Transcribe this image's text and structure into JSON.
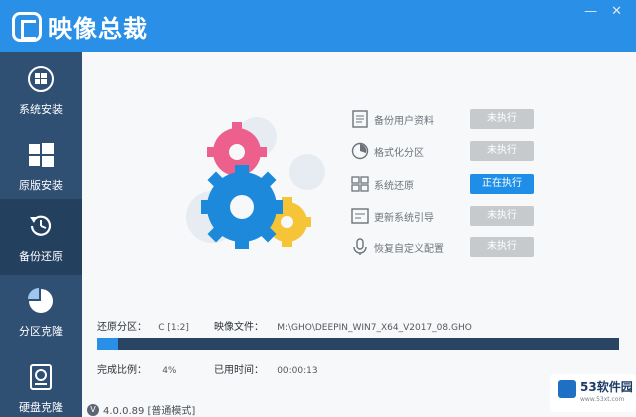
{
  "app": {
    "title": "映像总裁"
  },
  "window_controls": {
    "minimize": "—",
    "close": "✕"
  },
  "sidebar": {
    "items": [
      {
        "label": "系统安装",
        "icon": "windows-disc-icon"
      },
      {
        "label": "原版安装",
        "icon": "windows-logo-icon"
      },
      {
        "label": "备份还原",
        "icon": "backup-restore-icon",
        "active": true
      },
      {
        "label": "分区克隆",
        "icon": "pie-chart-icon"
      },
      {
        "label": "硬盘克隆",
        "icon": "disk-clone-icon"
      }
    ]
  },
  "tasks": [
    {
      "label": "备份用户资料",
      "status": "未执行",
      "icon": "document-icon"
    },
    {
      "label": "格式化分区",
      "status": "未执行",
      "icon": "format-disc-icon"
    },
    {
      "label": "系统还原",
      "status": "正在执行",
      "icon": "windows-grid-icon",
      "running": true
    },
    {
      "label": "更新系统引导",
      "status": "未执行",
      "icon": "boot-update-icon"
    },
    {
      "label": "恢复自定义配置",
      "status": "未执行",
      "icon": "config-icon"
    }
  ],
  "restore": {
    "partition_label": "还原分区：",
    "partition_value": "C [1:2]",
    "image_label": "映像文件：",
    "image_value": "M:\\GHO\\DEEPIN_WIN7_X64_V2017_08.GHO",
    "ratio_label": "完成比例：",
    "ratio_value": "4%",
    "time_label": "已用时间：",
    "time_value": "00:00:13",
    "progress_percent": 4
  },
  "version": {
    "badge": "V",
    "text": "4.0.0.89 [普通模式]"
  },
  "watermark": {
    "text": "53软件园",
    "url": "www.53xt.com"
  },
  "colors": {
    "titlebar": "#2a8fe6",
    "sidebar": "#2f4f73",
    "sidebar_active": "#23415f",
    "status_running": "#1f8ee8",
    "status_idle": "#c6cacd",
    "progress_track": "#2a4563",
    "progress_fill": "#2a8fe6"
  }
}
